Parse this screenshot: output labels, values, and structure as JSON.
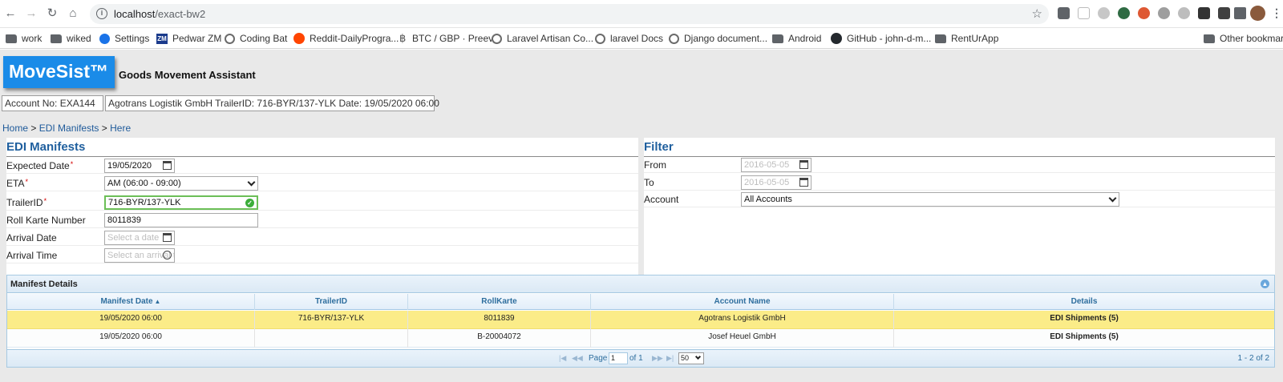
{
  "browser": {
    "url_host": "localhost",
    "url_path": "/exact-bw2",
    "bookmarks": [
      "work",
      "wiked",
      "Settings",
      "Pedwar ZM",
      "Coding Bat",
      "Reddit-DailyProgra...",
      "BTC / GBP · Preev",
      "Laravel Artisan Co...",
      "laravel Docs",
      "Django document...",
      "Android",
      "GitHub - john-d-m...",
      "RentUrApp"
    ],
    "other_bookmarks": "Other bookmarks"
  },
  "header": {
    "logo": "MoveSist™",
    "tagline": "Goods Movement Assistant",
    "account_no": "Account No: EXA144",
    "summary": "Agotrans Logistik GmbH TrailerID: 716-BYR/137-YLK Date: 19/05/2020 06:00"
  },
  "breadcrumb": {
    "home": "Home",
    "sep1": ">",
    "manifests": "EDI Manifests",
    "sep2": ">",
    "here": "Here"
  },
  "form": {
    "title": "EDI Manifests",
    "required_mark": "*",
    "expected_date": {
      "label": "Expected Date",
      "value": "19/05/2020"
    },
    "eta": {
      "label": "ETA",
      "value": "AM (06:00 - 09:00)"
    },
    "trailer_id": {
      "label": "TrailerID",
      "value": "716-BYR/137-YLK"
    },
    "roll_karte": {
      "label": "Roll Karte Number",
      "value": "8011839"
    },
    "arrival_date": {
      "label": "Arrival Date",
      "placeholder": "Select a date"
    },
    "arrival_time": {
      "label": "Arrival Time",
      "placeholder": "Select an arrival time"
    }
  },
  "filter": {
    "title": "Filter",
    "from": {
      "label": "From",
      "placeholder": "2016-05-05"
    },
    "to": {
      "label": "To",
      "placeholder": "2016-05-05"
    },
    "account": {
      "label": "Account",
      "value": "All Accounts"
    }
  },
  "grid": {
    "caption": "Manifest Details",
    "columns": [
      "Manifest Date",
      "TrailerID",
      "RollKarte",
      "Account Name",
      "Details"
    ],
    "rows": [
      {
        "date": "19/05/2020 06:00",
        "trailer": "716-BYR/137-YLK",
        "rollkarte": "8011839",
        "account": "Agotrans Logistik GmbH",
        "details": "EDI Shipments (5)"
      },
      {
        "date": "19/05/2020 06:00",
        "trailer": "",
        "rollkarte": "B-20004072",
        "account": "Josef Heuel GmbH",
        "details": "EDI Shipments (5)"
      }
    ],
    "pager": {
      "page_label": "Page",
      "page": "1",
      "of_label": "of 1",
      "rows_per_page": "50",
      "records": "1 - 2 of 2"
    }
  }
}
